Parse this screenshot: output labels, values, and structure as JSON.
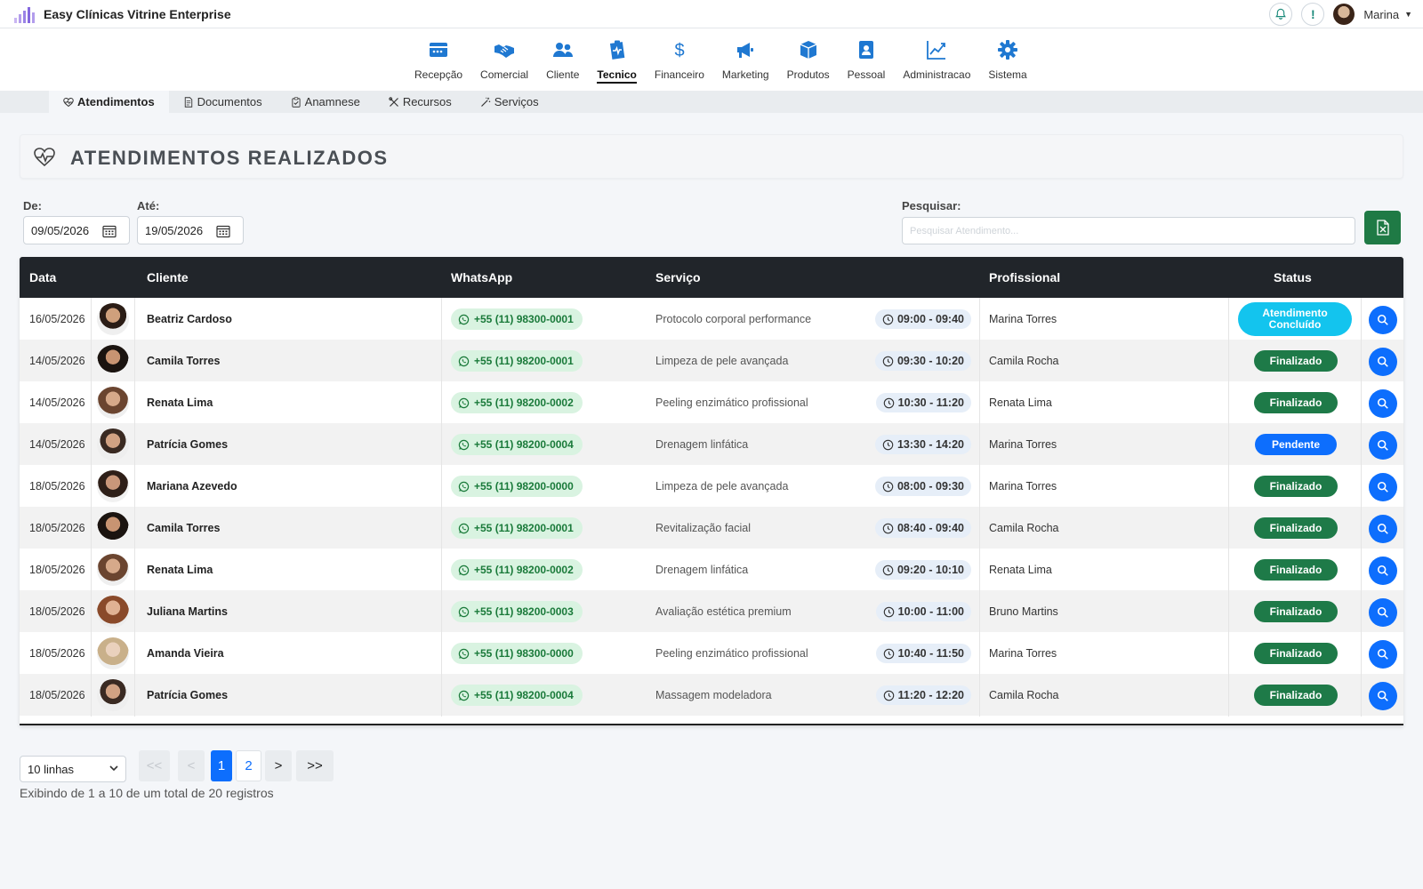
{
  "app": {
    "title": "Easy Clínicas Vitrine Enterprise"
  },
  "user": {
    "name": "Marina"
  },
  "top_actions": {
    "alert_label": "!"
  },
  "nav": [
    {
      "label": "Recepção",
      "icon": "reception-desk-icon"
    },
    {
      "label": "Comercial",
      "icon": "handshake-icon"
    },
    {
      "label": "Cliente",
      "icon": "users-icon"
    },
    {
      "label": "Tecnico",
      "icon": "clipboard-pulse-icon",
      "active": true
    },
    {
      "label": "Financeiro",
      "icon": "dollar-icon"
    },
    {
      "label": "Marketing",
      "icon": "megaphone-icon"
    },
    {
      "label": "Produtos",
      "icon": "box-icon"
    },
    {
      "label": "Pessoal",
      "icon": "id-badge-icon"
    },
    {
      "label": "Administracao",
      "icon": "chart-line-icon"
    },
    {
      "label": "Sistema",
      "icon": "gear-icon"
    }
  ],
  "subtabs": [
    {
      "label": "Atendimentos",
      "icon": "heart-pulse-icon",
      "active": true
    },
    {
      "label": "Documentos",
      "icon": "document-icon"
    },
    {
      "label": "Anamnese",
      "icon": "clipboard-check-icon"
    },
    {
      "label": "Recursos",
      "icon": "tools-icon"
    },
    {
      "label": "Serviços",
      "icon": "magic-wand-icon"
    }
  ],
  "page": {
    "title": "ATENDIMENTOS REALIZADOS"
  },
  "filters": {
    "from_label": "De:",
    "from_value": "09/05/2026",
    "to_label": "Até:",
    "to_value": "19/05/2026",
    "search_label": "Pesquisar:",
    "search_placeholder": "Pesquisar Atendimento..."
  },
  "table": {
    "headers": {
      "date": "Data",
      "client": "Cliente",
      "whatsapp": "WhatsApp",
      "service": "Serviço",
      "professional": "Profissional",
      "status": "Status"
    },
    "rows": [
      {
        "date": "16/05/2026",
        "client": "Beatriz Cardoso",
        "whatsapp": "+55 (11) 98300-0001",
        "service": "Protocolo corporal performance",
        "time": "09:00 - 09:40",
        "professional": "Marina Torres",
        "status": "Atendimento Concluído",
        "status_type": "conc"
      },
      {
        "date": "14/05/2026",
        "client": "Camila Torres",
        "whatsapp": "+55 (11) 98200-0001",
        "service": "Limpeza de pele avançada",
        "time": "09:30 - 10:20",
        "professional": "Camila Rocha",
        "status": "Finalizado",
        "status_type": "fin"
      },
      {
        "date": "14/05/2026",
        "client": "Renata Lima",
        "whatsapp": "+55 (11) 98200-0002",
        "service": "Peeling enzimático profissional",
        "time": "10:30 - 11:20",
        "professional": "Renata Lima",
        "status": "Finalizado",
        "status_type": "fin"
      },
      {
        "date": "14/05/2026",
        "client": "Patrícia Gomes",
        "whatsapp": "+55 (11) 98200-0004",
        "service": "Drenagem linfática",
        "time": "13:30 - 14:20",
        "professional": "Marina Torres",
        "status": "Pendente",
        "status_type": "pen"
      },
      {
        "date": "18/05/2026",
        "client": "Mariana Azevedo",
        "whatsapp": "+55 (11) 98200-0000",
        "service": "Limpeza de pele avançada",
        "time": "08:00 - 09:30",
        "professional": "Marina Torres",
        "status": "Finalizado",
        "status_type": "fin"
      },
      {
        "date": "18/05/2026",
        "client": "Camila Torres",
        "whatsapp": "+55 (11) 98200-0001",
        "service": "Revitalização facial",
        "time": "08:40 - 09:40",
        "professional": "Camila Rocha",
        "status": "Finalizado",
        "status_type": "fin"
      },
      {
        "date": "18/05/2026",
        "client": "Renata Lima",
        "whatsapp": "+55 (11) 98200-0002",
        "service": "Drenagem linfática",
        "time": "09:20 - 10:10",
        "professional": "Renata Lima",
        "status": "Finalizado",
        "status_type": "fin"
      },
      {
        "date": "18/05/2026",
        "client": "Juliana Martins",
        "whatsapp": "+55 (11) 98200-0003",
        "service": "Avaliação estética premium",
        "time": "10:00 - 11:00",
        "professional": "Bruno Martins",
        "status": "Finalizado",
        "status_type": "fin"
      },
      {
        "date": "18/05/2026",
        "client": "Amanda Vieira",
        "whatsapp": "+55 (11) 98300-0000",
        "service": "Peeling enzimático profissional",
        "time": "10:40 - 11:50",
        "professional": "Marina Torres",
        "status": "Finalizado",
        "status_type": "fin"
      },
      {
        "date": "18/05/2026",
        "client": "Patrícia Gomes",
        "whatsapp": "+55 (11) 98200-0004",
        "service": "Massagem modeladora",
        "time": "11:20 - 12:20",
        "professional": "Camila Rocha",
        "status": "Finalizado",
        "status_type": "fin"
      }
    ]
  },
  "pagination": {
    "rows_option": "10 linhas",
    "first": "<<",
    "prev": "<",
    "pages": [
      "1",
      "2"
    ],
    "current": "1",
    "next": ">",
    "last": ">>",
    "info": "Exibindo de 1 a 10 de um total de 20 registros"
  },
  "colors": {
    "primary": "#0d6efd",
    "success": "#1e7a48",
    "info": "#13c4ee",
    "header_dark": "#21252a",
    "whatsapp_bg": "#d9f3e1"
  }
}
